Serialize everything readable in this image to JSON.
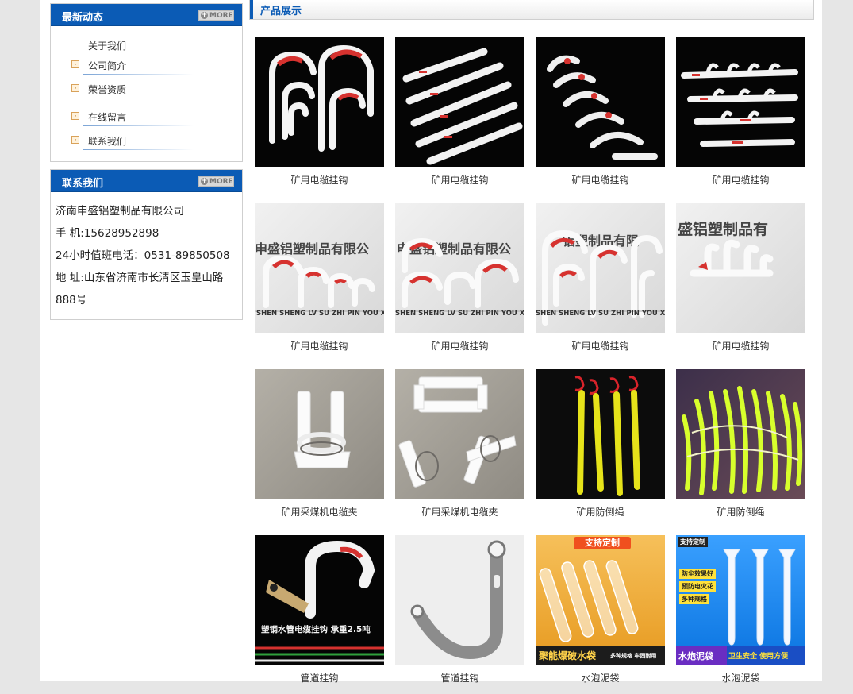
{
  "sidebar": {
    "news": {
      "title": "最新动态",
      "more": "MORE",
      "items": [
        {
          "label": "关于我们"
        },
        {
          "label": "公司简介"
        },
        {
          "label": "荣誉资质"
        },
        {
          "label": "在线留言"
        },
        {
          "label": "联系我们"
        }
      ]
    },
    "contact": {
      "title": "联系我们",
      "more": "MORE",
      "company": "济南申盛铝塑制品有限公司",
      "mobile": "手  机:15628952898",
      "hotline": "24小时值班电话：0531-89850508",
      "address": "地  址:山东省济南市长清区玉皇山路888号"
    }
  },
  "content": {
    "title": "产品展示",
    "products": [
      {
        "caption": "矿用电缆挂钩",
        "image": "hook-set-black-1"
      },
      {
        "caption": "矿用电缆挂钩",
        "image": "hook-rack-black-1"
      },
      {
        "caption": "矿用电缆挂钩",
        "image": "hook-set-black-2"
      },
      {
        "caption": "矿用电缆挂钩",
        "image": "hook-rack-black-2"
      },
      {
        "caption": "矿用电缆挂钩",
        "image": "hook-set-grey-1",
        "overlay_top": "申盛铝塑制品有限公",
        "overlay_bottom": "SHEN SHENG LV SU ZHI PIN YOU XIAN G"
      },
      {
        "caption": "矿用电缆挂钩",
        "image": "hook-set-grey-2",
        "overlay_top": "申盛铝塑制品有限公",
        "overlay_bottom": "SHEN SHENG LV SU ZHI PIN YOU XIAN G"
      },
      {
        "caption": "矿用电缆挂钩",
        "image": "hook-set-grey-3",
        "overlay_top": "铝塑制品有限",
        "overlay_bottom": "SHEN SHENG LV SU ZHI PIN YOU XIAN"
      },
      {
        "caption": "矿用电缆挂钩",
        "image": "hook-rack-grey",
        "overlay_top": "盛铝塑制品有"
      },
      {
        "caption": "矿用采煤机电缆夹",
        "image": "cable-clamp-wood-1"
      },
      {
        "caption": "矿用采煤机电缆夹",
        "image": "cable-clamp-wood-2"
      },
      {
        "caption": "矿用防倒绳",
        "image": "rope-dark"
      },
      {
        "caption": "矿用防倒绳",
        "image": "rope-purple"
      },
      {
        "caption": "管道挂钩",
        "image": "pipe-hook-1",
        "overlay_bottom": "塑钢水管电缆挂钩    承重2.5吨"
      },
      {
        "caption": "管道挂钩",
        "image": "pipe-hook-2"
      },
      {
        "caption": "水泡泥袋",
        "image": "water-bag-1",
        "overlay_top": "支持定制",
        "overlay_bottom": "聚能爆破水袋",
        "overlay_extra": "多种规格  牢固耐用"
      },
      {
        "caption": "水泡泥袋",
        "image": "water-bag-2",
        "overlay_top": "支持定制",
        "overlay_bottom": "水炮泥袋",
        "overlay_extra": "卫生安全 使用方便",
        "badges": [
          "防尘效果好",
          "预防电火花",
          "多种规格"
        ]
      }
    ]
  }
}
